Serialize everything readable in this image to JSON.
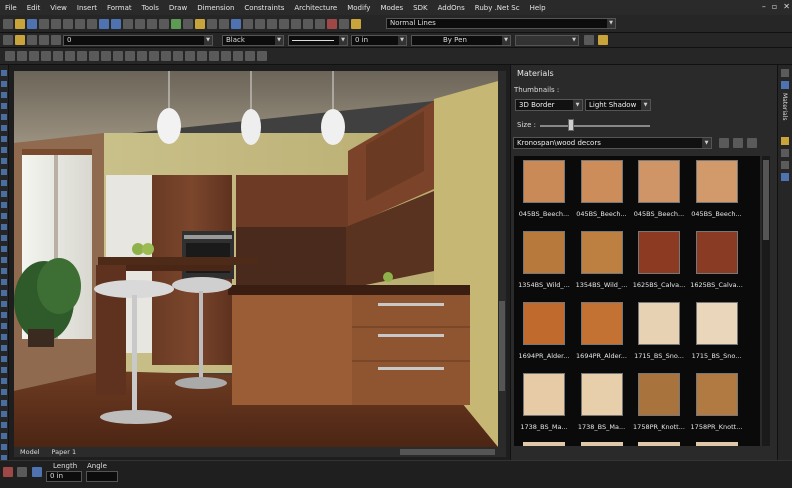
{
  "menu": [
    "File",
    "Edit",
    "View",
    "Insert",
    "Format",
    "Tools",
    "Draw",
    "Dimension",
    "Constraints",
    "Architecture",
    "Modify",
    "Modes",
    "SDK",
    "AddOns",
    "Ruby .Net Sc",
    "Help"
  ],
  "window_controls": {
    "minimize": "–",
    "restore": "▫",
    "close": "✕"
  },
  "toolbar": {
    "visual_style": "Normal Lines",
    "layer_value": "0",
    "color_value": "Black",
    "thickness_value": "0 in",
    "linetype_value": "By Pen"
  },
  "viewport": {
    "tabs": [
      "Model",
      "Paper 1"
    ]
  },
  "status": {
    "length_label": "Length",
    "angle_label": "Angle",
    "length_value": "0 in"
  },
  "materials_panel": {
    "title": "Materials",
    "thumbnails_label": "Thumbnails :",
    "border_mode": "3D Border",
    "shadow_mode": "Light Shadow",
    "size_label": "Size :",
    "library": "Kronospan\\wood decors",
    "side_tab": "Materials",
    "size_level": 0.3,
    "items": [
      {
        "label": "045BS_Beech...",
        "color": "#c98a58"
      },
      {
        "label": "045BS_Beech...",
        "color": "#cc8d5b"
      },
      {
        "label": "045BS_Beech...",
        "color": "#d09566"
      },
      {
        "label": "045BS_Beech...",
        "color": "#d2996a"
      },
      {
        "label": "1354BS_Wild_...",
        "color": "#b87a3c"
      },
      {
        "label": "1354BS_Wild_...",
        "color": "#bd8040"
      },
      {
        "label": "1625BS_Calva...",
        "color": "#8c3a22"
      },
      {
        "label": "1625BS_Calva...",
        "color": "#8a3b24"
      },
      {
        "label": "1694PR_Alder...",
        "color": "#c06a2e"
      },
      {
        "label": "1694PR_Alder...",
        "color": "#c47234"
      },
      {
        "label": "1715_BS_Sno...",
        "color": "#e8d2b4"
      },
      {
        "label": "1715_BS_Sno...",
        "color": "#ead6ba"
      },
      {
        "label": "1738_BS_Ma...",
        "color": "#e6cba6"
      },
      {
        "label": "1738_BS_Ma...",
        "color": "#e8cfac"
      },
      {
        "label": "1758PR_Knott...",
        "color": "#a8733c"
      },
      {
        "label": "1758PR_Knott...",
        "color": "#b07a42"
      }
    ]
  }
}
